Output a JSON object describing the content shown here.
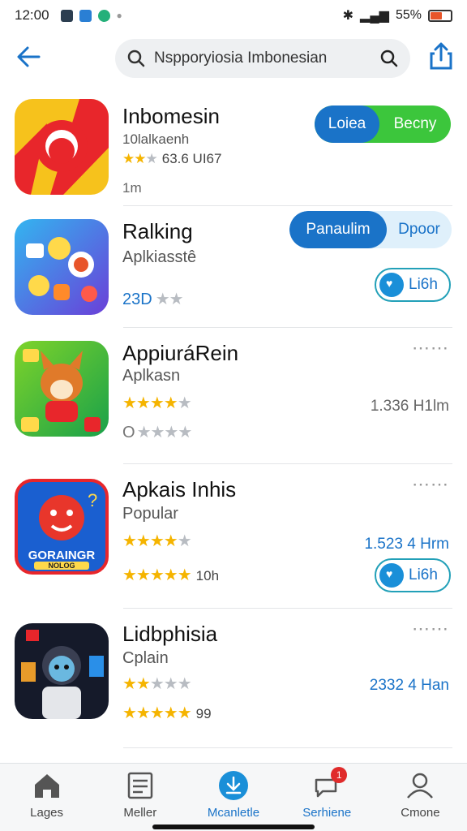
{
  "status": {
    "time": "12:00",
    "battery": "55%"
  },
  "search": {
    "query": "Nspporyiosia Imbonesian"
  },
  "apps": [
    {
      "name": "Inbomesin",
      "subtitle": "10lalkaenh",
      "rating_label": "63.6 UI67",
      "meta": "1m",
      "actions": {
        "primary": "Loiea",
        "secondary": "Becny"
      }
    },
    {
      "name": "Ralking",
      "subtitle": "Aplkiasstê",
      "rating_prefix": "23D",
      "actions": {
        "primary": "Panaulim",
        "secondary": "Dpoor",
        "pill": "Li6h"
      }
    },
    {
      "name": "AppiuráRein",
      "subtitle": "Aplkasn",
      "downloads": "1.336 H1lm",
      "rating_prefix": "O"
    },
    {
      "name": "Apkais Inhis",
      "subtitle": "Popular",
      "downloads": "1.523 4 Hrm",
      "rating_label": "10h",
      "icon_text": "GORAINGR",
      "icon_subtext": "NOLOG",
      "actions": {
        "pill": "Li6h"
      }
    },
    {
      "name": "Lidbphisia",
      "subtitle": "Cplain",
      "downloads": "2332 4 Han",
      "rating_label": "99"
    }
  ],
  "nav": [
    {
      "label": "Lages",
      "icon": "home-icon"
    },
    {
      "label": "Meller",
      "icon": "list-icon"
    },
    {
      "label": "Mcanletle",
      "icon": "download-icon"
    },
    {
      "label": "Serhiene",
      "icon": "bell-icon",
      "badge": "1"
    },
    {
      "label": "Cmone",
      "icon": "person-icon"
    }
  ],
  "colors": {
    "accent": "#1a73c8",
    "green": "#3cc63c",
    "star": "#f5b400"
  }
}
